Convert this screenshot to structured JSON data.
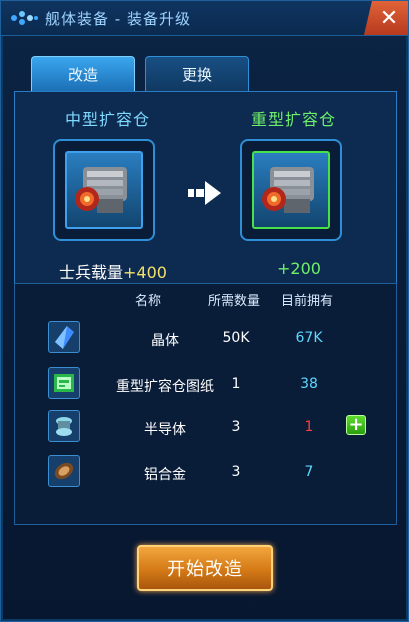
{
  "window": {
    "title": "舰体装备 - 装备升级",
    "close_icon": "close-icon"
  },
  "tabs": [
    {
      "label": "改造",
      "active": true
    },
    {
      "label": "更换",
      "active": false
    }
  ],
  "upgrade": {
    "from": {
      "name": "中型扩容仓",
      "stat_label": "士兵载量",
      "stat_value": "+400"
    },
    "to": {
      "name": "重型扩容仓",
      "stat_value": "+200"
    }
  },
  "table": {
    "headers": {
      "name": "名称",
      "required": "所需数量",
      "owned": "目前拥有"
    },
    "rows": [
      {
        "icon": "crystal-icon",
        "name": "晶体",
        "required": "50K",
        "owned": "67K",
        "sufficient": true
      },
      {
        "icon": "blueprint-icon",
        "name": "重型扩容仓图纸",
        "required": "1",
        "owned": "38",
        "sufficient": true
      },
      {
        "icon": "semiconductor-icon",
        "name": "半导体",
        "required": "3",
        "owned": "1",
        "sufficient": false
      },
      {
        "icon": "aluminum-alloy-icon",
        "name": "铝合金",
        "required": "3",
        "owned": "7",
        "sufficient": true
      }
    ]
  },
  "actions": {
    "start_label": "开始改造",
    "add_icon": "plus-icon"
  },
  "colors": {
    "accent_blue": "#2f8fd6",
    "upgrade_green": "#6ff06a",
    "stat_yellow": "#f4e26a",
    "insufficient_red": "#ff3b3b",
    "button_orange": "#d47a17"
  }
}
